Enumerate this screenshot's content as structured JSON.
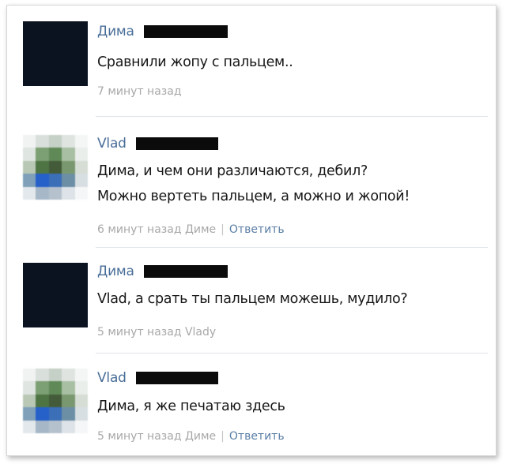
{
  "comments": [
    {
      "author": "Дима",
      "avatar": "black",
      "lines": [
        "Сравнили жопу с пальцем.."
      ],
      "time": "7 минут назад",
      "reply_to": "",
      "reply_label": ""
    },
    {
      "author": "Vlad",
      "avatar": "pixelated",
      "lines": [
        "Дима, и чем они различаются, дебил?",
        "Можно вертеть пальцем, а можно и жопой!"
      ],
      "time": "6 минут назад",
      "reply_to": "Диме",
      "reply_label": "Ответить"
    },
    {
      "author": "Дима",
      "avatar": "black",
      "lines": [
        "Vlad, а срать ты пальцем можешь, мудило?"
      ],
      "time": "5 минут назад",
      "reply_to": "Vlady",
      "reply_label": ""
    },
    {
      "author": "Vlad",
      "avatar": "pixelated",
      "lines": [
        "Дима, я же печатаю здесь"
      ],
      "time": "5 минут назад",
      "reply_to": "Диме",
      "reply_label": "Ответить"
    }
  ],
  "colors": {
    "author_link": "#4a6e98",
    "meta_gray": "#a8a8a8",
    "reply_link": "#5a7ea6",
    "redaction": "#0b0b0b",
    "avatar_black": "#0b1220"
  }
}
